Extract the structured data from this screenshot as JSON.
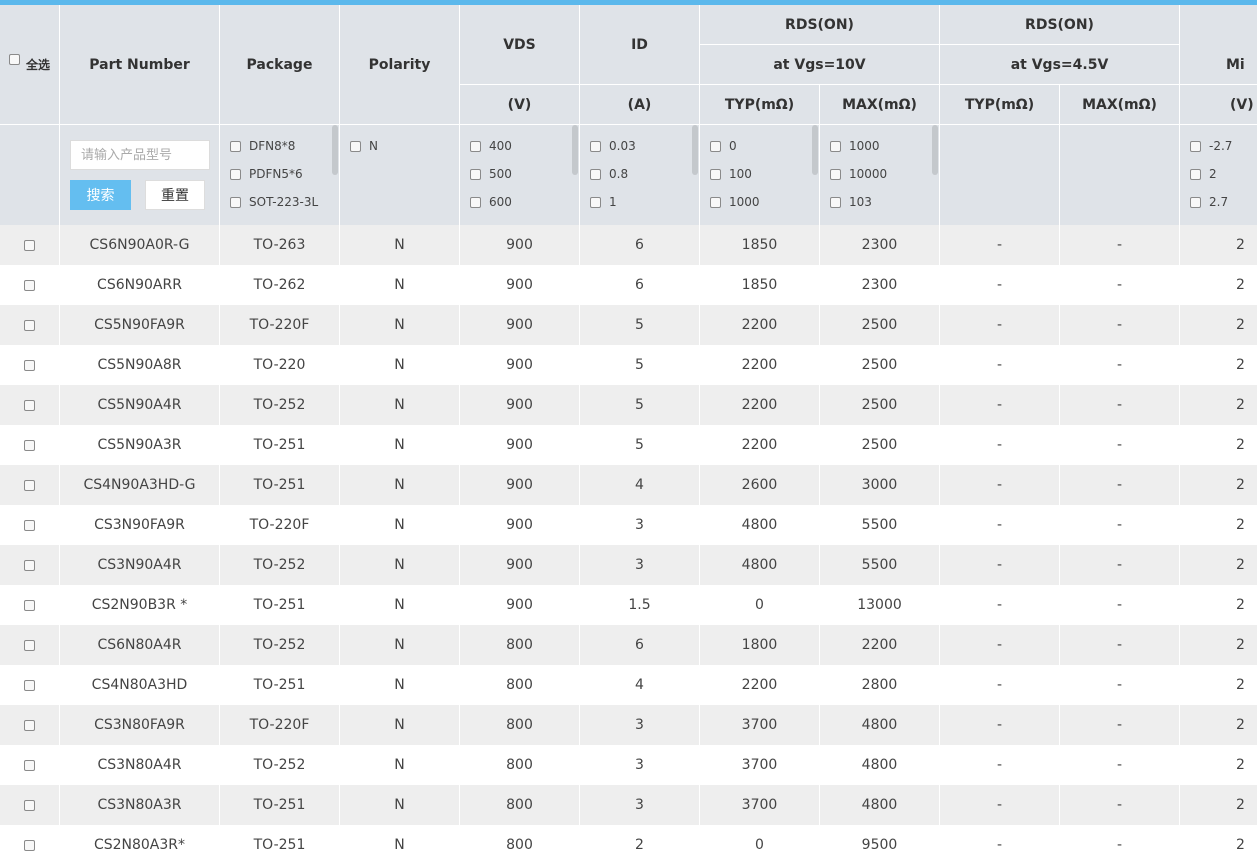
{
  "header": {
    "select_all": "全选",
    "part_number": "Part Number",
    "package": "Package",
    "polarity": "Polarity",
    "vds": "VDS",
    "vds_unit": "(V)",
    "id": "ID",
    "id_unit": "(A)",
    "rds_on_10": "RDS(ON)",
    "rds_on_10_cond": "at Vgs=10V",
    "rds_on_45": "RDS(ON)",
    "rds_on_45_cond": "at Vgs=4.5V",
    "min": "Mi",
    "min_unit": "(V)",
    "typ_10": "TYP(mΩ)",
    "max_10": "MAX(mΩ)",
    "typ_45": "TYP(mΩ)",
    "max_45": "MAX(mΩ)"
  },
  "filters": {
    "search_placeholder": "请输入产品型号",
    "search_button": "搜索",
    "reset_button": "重置",
    "package_options": [
      "DFN8*8",
      "PDFN5*6",
      "SOT-223-3L"
    ],
    "polarity_options": [
      "N"
    ],
    "vds_options": [
      "400",
      "500",
      "600"
    ],
    "id_options": [
      "0.03",
      "0.8",
      "1"
    ],
    "typ10_options": [
      "0",
      "100",
      "1000"
    ],
    "max10_options": [
      "1000",
      "10000",
      "103"
    ],
    "min_options": [
      "-2.7",
      "2",
      "2.7"
    ]
  },
  "rows": [
    {
      "part": "CS6N90A0R-G",
      "package": "TO-263",
      "polarity": "N",
      "vds": "900",
      "id": "6",
      "typ10": "1850",
      "max10": "2300",
      "typ45": "-",
      "max45": "-",
      "min": "2"
    },
    {
      "part": "CS6N90ARR",
      "package": "TO-262",
      "polarity": "N",
      "vds": "900",
      "id": "6",
      "typ10": "1850",
      "max10": "2300",
      "typ45": "-",
      "max45": "-",
      "min": "2"
    },
    {
      "part": "CS5N90FA9R",
      "package": "TO-220F",
      "polarity": "N",
      "vds": "900",
      "id": "5",
      "typ10": "2200",
      "max10": "2500",
      "typ45": "-",
      "max45": "-",
      "min": "2"
    },
    {
      "part": "CS5N90A8R",
      "package": "TO-220",
      "polarity": "N",
      "vds": "900",
      "id": "5",
      "typ10": "2200",
      "max10": "2500",
      "typ45": "-",
      "max45": "-",
      "min": "2"
    },
    {
      "part": "CS5N90A4R",
      "package": "TO-252",
      "polarity": "N",
      "vds": "900",
      "id": "5",
      "typ10": "2200",
      "max10": "2500",
      "typ45": "-",
      "max45": "-",
      "min": "2"
    },
    {
      "part": "CS5N90A3R",
      "package": "TO-251",
      "polarity": "N",
      "vds": "900",
      "id": "5",
      "typ10": "2200",
      "max10": "2500",
      "typ45": "-",
      "max45": "-",
      "min": "2"
    },
    {
      "part": "CS4N90A3HD-G",
      "package": "TO-251",
      "polarity": "N",
      "vds": "900",
      "id": "4",
      "typ10": "2600",
      "max10": "3000",
      "typ45": "-",
      "max45": "-",
      "min": "2"
    },
    {
      "part": "CS3N90FA9R",
      "package": "TO-220F",
      "polarity": "N",
      "vds": "900",
      "id": "3",
      "typ10": "4800",
      "max10": "5500",
      "typ45": "-",
      "max45": "-",
      "min": "2"
    },
    {
      "part": "CS3N90A4R",
      "package": "TO-252",
      "polarity": "N",
      "vds": "900",
      "id": "3",
      "typ10": "4800",
      "max10": "5500",
      "typ45": "-",
      "max45": "-",
      "min": "2"
    },
    {
      "part": "CS2N90B3R *",
      "package": "TO-251",
      "polarity": "N",
      "vds": "900",
      "id": "1.5",
      "typ10": "0",
      "max10": "13000",
      "typ45": "-",
      "max45": "-",
      "min": "2"
    },
    {
      "part": "CS6N80A4R",
      "package": "TO-252",
      "polarity": "N",
      "vds": "800",
      "id": "6",
      "typ10": "1800",
      "max10": "2200",
      "typ45": "-",
      "max45": "-",
      "min": "2"
    },
    {
      "part": "CS4N80A3HD",
      "package": "TO-251",
      "polarity": "N",
      "vds": "800",
      "id": "4",
      "typ10": "2200",
      "max10": "2800",
      "typ45": "-",
      "max45": "-",
      "min": "2"
    },
    {
      "part": "CS3N80FA9R",
      "package": "TO-220F",
      "polarity": "N",
      "vds": "800",
      "id": "3",
      "typ10": "3700",
      "max10": "4800",
      "typ45": "-",
      "max45": "-",
      "min": "2"
    },
    {
      "part": "CS3N80A4R",
      "package": "TO-252",
      "polarity": "N",
      "vds": "800",
      "id": "3",
      "typ10": "3700",
      "max10": "4800",
      "typ45": "-",
      "max45": "-",
      "min": "2"
    },
    {
      "part": "CS3N80A3R",
      "package": "TO-251",
      "polarity": "N",
      "vds": "800",
      "id": "3",
      "typ10": "3700",
      "max10": "4800",
      "typ45": "-",
      "max45": "-",
      "min": "2"
    },
    {
      "part": "CS2N80A3R*",
      "package": "TO-251",
      "polarity": "N",
      "vds": "800",
      "id": "2",
      "typ10": "0",
      "max10": "9500",
      "typ45": "-",
      "max45": "-",
      "min": "2"
    }
  ]
}
